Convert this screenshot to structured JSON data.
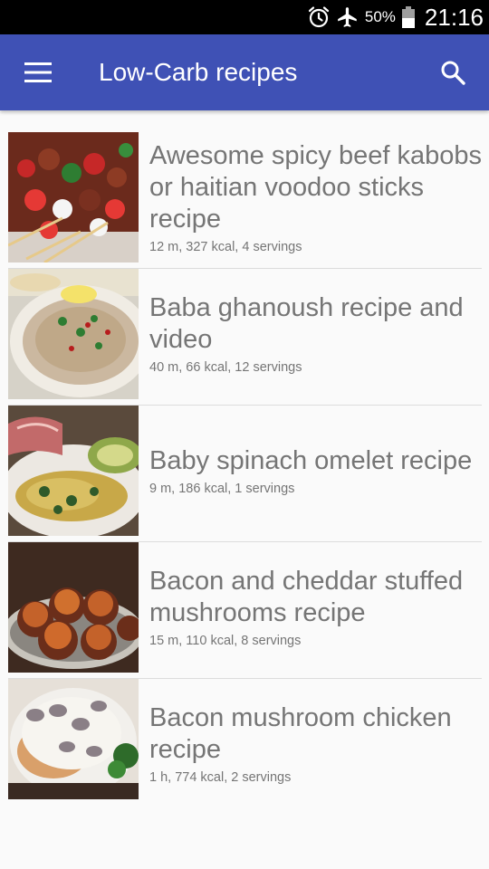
{
  "status_bar": {
    "battery_percent": "50%",
    "time": "21:16",
    "icons": [
      "alarm-icon",
      "airplane-mode-icon",
      "battery-icon"
    ]
  },
  "app_bar": {
    "title": "Low-Carb recipes",
    "icons": [
      "menu-icon",
      "search-icon"
    ]
  },
  "recipes": [
    {
      "title": "Awesome spicy beef kabobs or haitian voodoo sticks recipe",
      "meta": "12 m, 327 kcal, 4 servings"
    },
    {
      "title": "Baba ghanoush recipe and video",
      "meta": "40 m, 66 kcal, 12 servings"
    },
    {
      "title": "Baby spinach omelet recipe",
      "meta": "9 m, 186 kcal, 1 servings"
    },
    {
      "title": "Bacon and cheddar stuffed mushrooms recipe",
      "meta": "15 m, 110 kcal, 8 servings"
    },
    {
      "title": "Bacon mushroom chicken recipe",
      "meta": "1 h, 774 kcal, 2 servings"
    }
  ],
  "colors": {
    "app_bar": "#3f51b5",
    "status_bar": "#000000",
    "text_secondary": "#757575",
    "background": "#fafafa"
  }
}
